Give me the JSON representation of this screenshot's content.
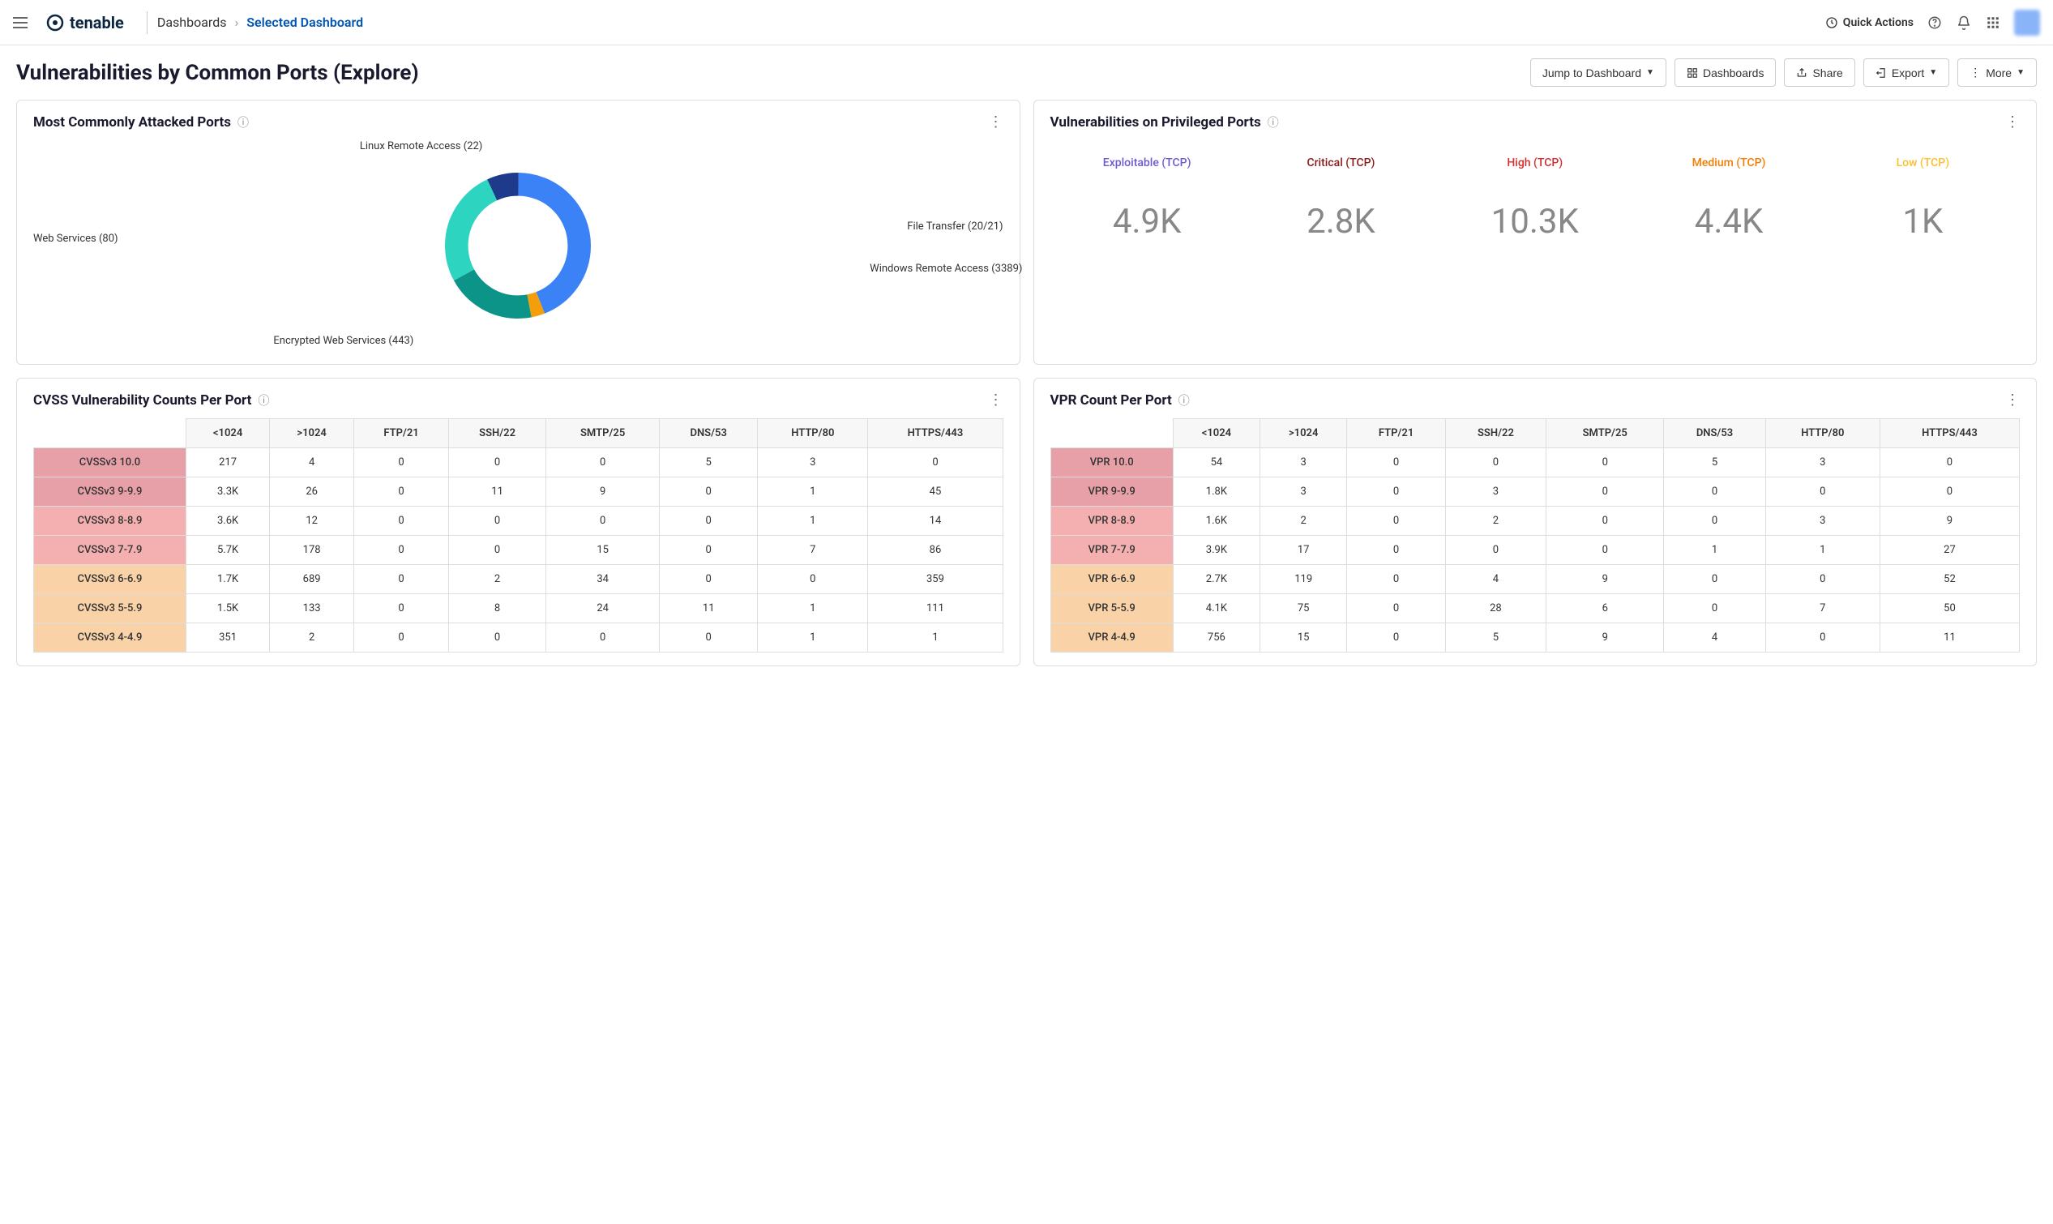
{
  "header": {
    "brand": "tenable",
    "breadcrumb_root": "Dashboards",
    "breadcrumb_current": "Selected Dashboard",
    "quick_actions": "Quick Actions"
  },
  "page": {
    "title": "Vulnerabilities by Common Ports (Explore)",
    "actions": {
      "jump": "Jump to Dashboard",
      "dashboards": "Dashboards",
      "share": "Share",
      "export": "Export",
      "more": "More"
    }
  },
  "card_ports": {
    "title": "Most Commonly Attacked Ports",
    "labels": {
      "linux": "Linux Remote Access (22)",
      "file": "File Transfer (20/21)",
      "windows": "Windows Remote Access (3389)",
      "enc": "Encrypted Web Services (443)",
      "web": "Web Services (80)"
    }
  },
  "card_priv": {
    "title": "Vulnerabilities on Privileged Ports",
    "metrics": [
      {
        "label": "Exploitable (TCP)",
        "value": "4.9K",
        "color": "c-purple"
      },
      {
        "label": "Critical (TCP)",
        "value": "2.8K",
        "color": "c-darkred"
      },
      {
        "label": "High (TCP)",
        "value": "10.3K",
        "color": "c-red"
      },
      {
        "label": "Medium (TCP)",
        "value": "4.4K",
        "color": "c-orange"
      },
      {
        "label": "Low (TCP)",
        "value": "1K",
        "color": "c-yellow"
      }
    ]
  },
  "card_cvss": {
    "title": "CVSS Vulnerability Counts Per Port",
    "columns": [
      "<1024",
      ">1024",
      "FTP/21",
      "SSH/22",
      "SMTP/25",
      "DNS/53",
      "HTTP/80",
      "HTTPS/443"
    ],
    "rows": [
      {
        "label": "CVSSv3 10.0",
        "sev": "sev-crit",
        "cells": [
          "217",
          "4",
          "0",
          "0",
          "0",
          "5",
          "3",
          "0"
        ]
      },
      {
        "label": "CVSSv3 9-9.9",
        "sev": "sev-crit",
        "cells": [
          "3.3K",
          "26",
          "0",
          "11",
          "9",
          "0",
          "1",
          "45"
        ]
      },
      {
        "label": "CVSSv3 8-8.9",
        "sev": "sev-high",
        "cells": [
          "3.6K",
          "12",
          "0",
          "0",
          "0",
          "0",
          "1",
          "14"
        ]
      },
      {
        "label": "CVSSv3 7-7.9",
        "sev": "sev-high",
        "cells": [
          "5.7K",
          "178",
          "0",
          "0",
          "15",
          "0",
          "7",
          "86"
        ]
      },
      {
        "label": "CVSSv3 6-6.9",
        "sev": "sev-med",
        "cells": [
          "1.7K",
          "689",
          "0",
          "2",
          "34",
          "0",
          "0",
          "359"
        ]
      },
      {
        "label": "CVSSv3 5-5.9",
        "sev": "sev-med",
        "cells": [
          "1.5K",
          "133",
          "0",
          "8",
          "24",
          "11",
          "1",
          "111"
        ]
      },
      {
        "label": "CVSSv3 4-4.9",
        "sev": "sev-med",
        "cells": [
          "351",
          "2",
          "0",
          "0",
          "0",
          "0",
          "1",
          "1"
        ]
      }
    ]
  },
  "card_vpr": {
    "title": "VPR Count Per Port",
    "columns": [
      "<1024",
      ">1024",
      "FTP/21",
      "SSH/22",
      "SMTP/25",
      "DNS/53",
      "HTTP/80",
      "HTTPS/443"
    ],
    "rows": [
      {
        "label": "VPR 10.0",
        "sev": "sev-crit",
        "cells": [
          "54",
          "3",
          "0",
          "0",
          "0",
          "5",
          "3",
          "0"
        ]
      },
      {
        "label": "VPR 9-9.9",
        "sev": "sev-crit",
        "cells": [
          "1.8K",
          "3",
          "0",
          "3",
          "0",
          "0",
          "0",
          "0"
        ]
      },
      {
        "label": "VPR 8-8.9",
        "sev": "sev-high",
        "cells": [
          "1.6K",
          "2",
          "0",
          "2",
          "0",
          "0",
          "3",
          "9"
        ]
      },
      {
        "label": "VPR 7-7.9",
        "sev": "sev-high",
        "cells": [
          "3.9K",
          "17",
          "0",
          "0",
          "0",
          "1",
          "1",
          "27"
        ]
      },
      {
        "label": "VPR 6-6.9",
        "sev": "sev-med",
        "cells": [
          "2.7K",
          "119",
          "0",
          "4",
          "9",
          "0",
          "0",
          "52"
        ]
      },
      {
        "label": "VPR 5-5.9",
        "sev": "sev-med",
        "cells": [
          "4.1K",
          "75",
          "0",
          "28",
          "6",
          "0",
          "7",
          "50"
        ]
      },
      {
        "label": "VPR 4-4.9",
        "sev": "sev-med",
        "cells": [
          "756",
          "15",
          "0",
          "5",
          "9",
          "4",
          "0",
          "11"
        ]
      }
    ]
  },
  "chart_data": {
    "type": "pie",
    "title": "Most Commonly Attacked Ports",
    "series": [
      {
        "name": "Linux Remote Access (22)",
        "value": 44,
        "color": "#3b82f6"
      },
      {
        "name": "File Transfer (20/21)",
        "value": 3,
        "color": "#f59e0b"
      },
      {
        "name": "Windows Remote Access (3389)",
        "value": 20,
        "color": "#0d9488"
      },
      {
        "name": "Encrypted Web Services (443)",
        "value": 26,
        "color": "#2dd4bf"
      },
      {
        "name": "Web Services (80)",
        "value": 7,
        "color": "#1e3a8a"
      }
    ]
  }
}
